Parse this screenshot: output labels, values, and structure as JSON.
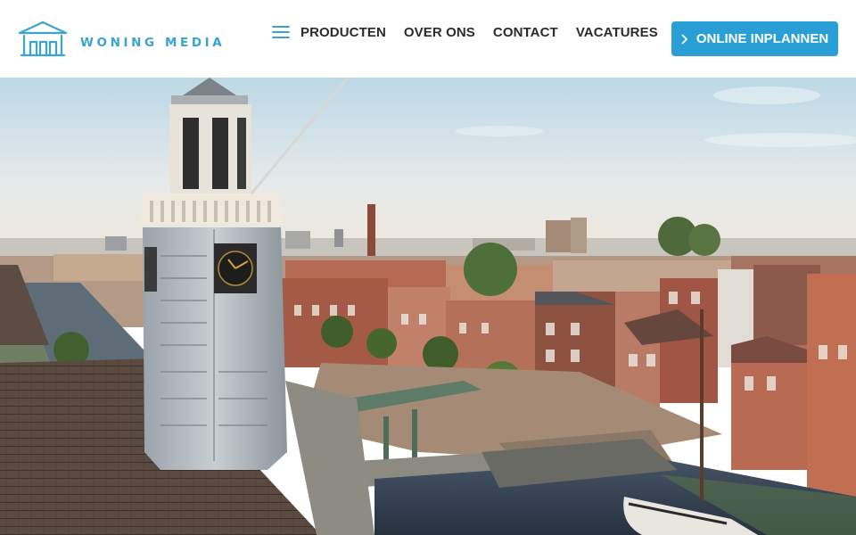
{
  "brand": {
    "name": "WONING MEDIA",
    "color": "#3ba3d0"
  },
  "nav": {
    "menu_icon": "hamburger-icon",
    "items": [
      {
        "label": "PRODUCTEN"
      },
      {
        "label": "OVER ONS"
      },
      {
        "label": "CONTACT"
      },
      {
        "label": "VACATURES"
      }
    ]
  },
  "cta": {
    "label": "ONLINE INPLANNEN",
    "icon": "chevron-right-icon",
    "color": "#2a9fd6"
  },
  "hero": {
    "subject": "aerial photo of church tower and canal houses"
  }
}
